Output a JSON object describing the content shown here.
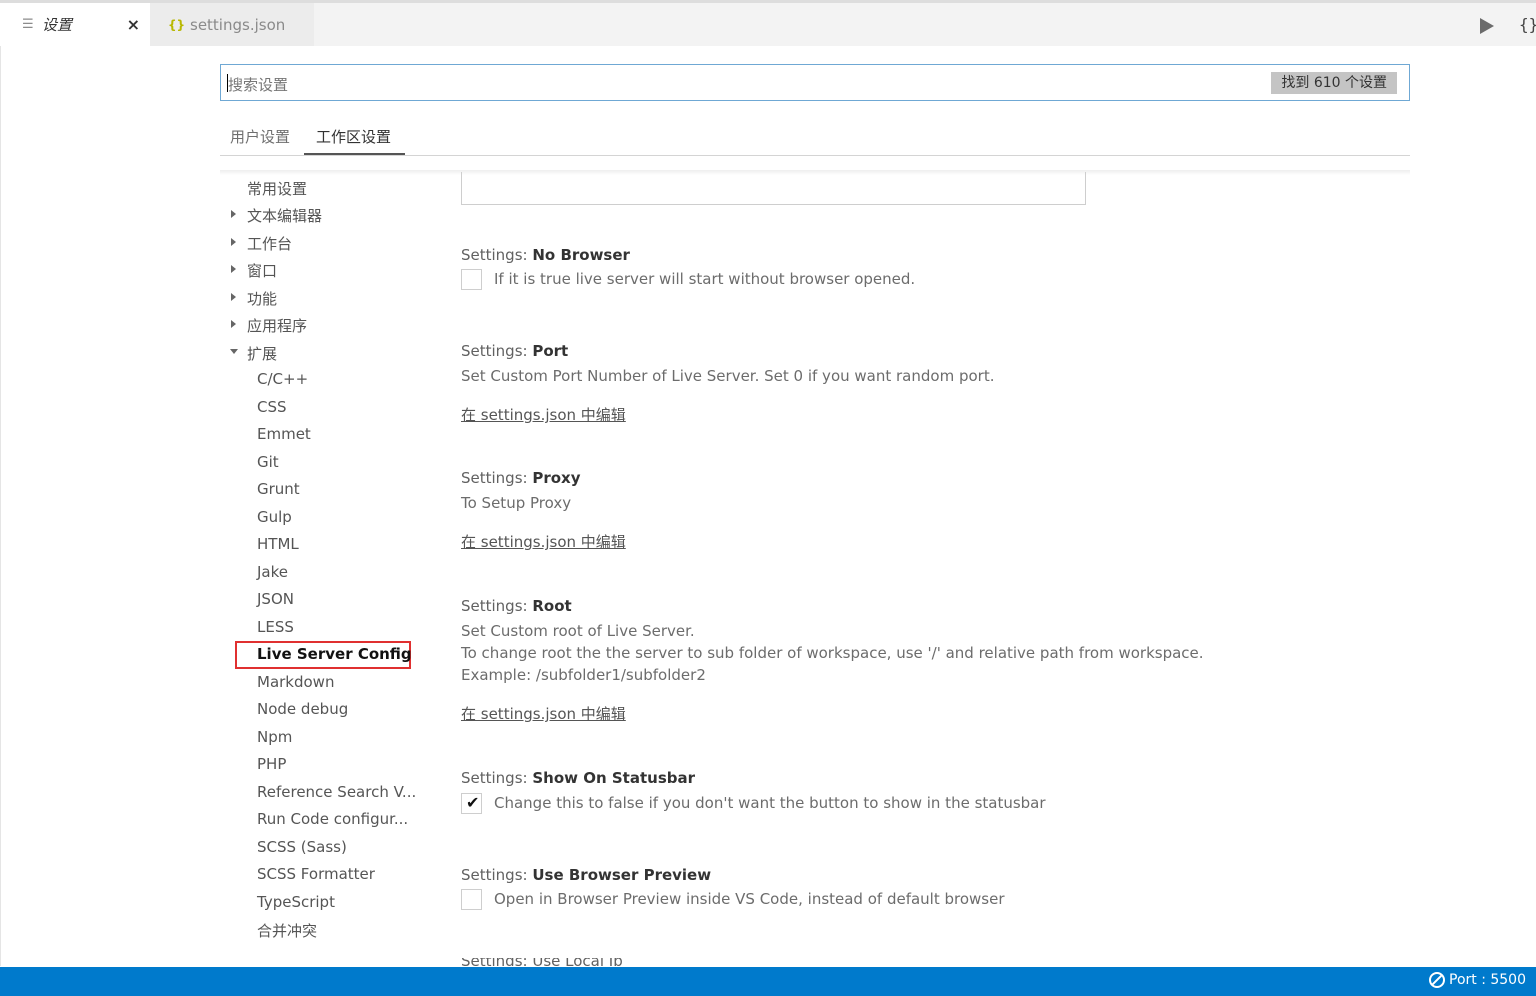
{
  "tabs": [
    {
      "label": "设置",
      "icon": "lines-icon",
      "active": true,
      "close": "×"
    },
    {
      "label": "settings.json",
      "icon": "braces-icon",
      "icon_glyph": "{}",
      "active": false
    }
  ],
  "editor_actions": {
    "run_icon": "play-icon",
    "split_json": "{}"
  },
  "search": {
    "placeholder": "搜索设置",
    "count": "找到 610 个设置"
  },
  "scope_tabs": {
    "user": "用户设置",
    "workspace": "工作区设置",
    "active": "workspace"
  },
  "toc": {
    "top": [
      {
        "label": "常用设置",
        "expander": "none"
      },
      {
        "label": "文本编辑器",
        "expander": "collapsed"
      },
      {
        "label": "工作台",
        "expander": "collapsed"
      },
      {
        "label": "窗口",
        "expander": "collapsed"
      },
      {
        "label": "功能",
        "expander": "collapsed"
      },
      {
        "label": "应用程序",
        "expander": "collapsed"
      },
      {
        "label": "扩展",
        "expander": "expanded"
      }
    ],
    "extensions": [
      "C/C++",
      "CSS",
      "Emmet",
      "Git",
      "Grunt",
      "Gulp",
      "HTML",
      "Jake",
      "JSON",
      "LESS",
      "Live Server Config",
      "Markdown",
      "Node debug",
      "Npm",
      "PHP",
      "Reference Search V...",
      "Run Code configur...",
      "SCSS (Sass)",
      "SCSS Formatter",
      "TypeScript",
      "合并冲突"
    ],
    "selected": "Live Server Config"
  },
  "settings": {
    "no_browser": {
      "prefix": "Settings: ",
      "name": "No Browser",
      "checked": false,
      "desc": "If it is true live server will start without browser opened."
    },
    "port": {
      "prefix": "Settings: ",
      "name": "Port",
      "desc": "Set Custom Port Number of Live Server. Set 0 if you want random port.",
      "link": "在 settings.json 中编辑"
    },
    "proxy": {
      "prefix": "Settings: ",
      "name": "Proxy",
      "desc": "To Setup Proxy",
      "link": "在 settings.json 中编辑"
    },
    "root": {
      "prefix": "Settings: ",
      "name": "Root",
      "desc1": "Set Custom root of Live Server.",
      "desc2": "To change root the the server to sub folder of workspace, use '/' and relative path from workspace.",
      "desc3": "Example: /subfolder1/subfolder2",
      "link": "在 settings.json 中编辑"
    },
    "show_on_statusbar": {
      "prefix": "Settings: ",
      "name": "Show On Statusbar",
      "checked": true,
      "desc": "Change this to false if you don't want the button to show in the statusbar"
    },
    "use_browser_preview": {
      "prefix": "Settings: ",
      "name": "Use Browser Preview",
      "checked": false,
      "desc": "Open in Browser Preview inside VS Code, instead of default browser"
    },
    "next_partial": {
      "text": "Settings: Use Local Ip"
    }
  },
  "statusbar": {
    "port": "Port : 5500",
    "icon": "no-entry-icon"
  },
  "colors": {
    "statusbar": "#007acc",
    "highlight_box": "#e03030",
    "search_border": "#6fa8d4"
  }
}
